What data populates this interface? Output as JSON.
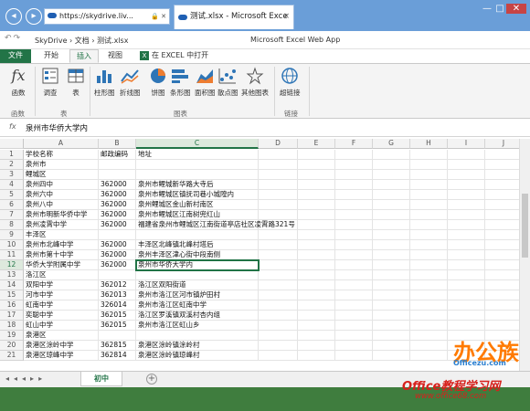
{
  "browser": {
    "address": "https://skydrive.liv...",
    "tab_title": "测试.xlsx - Microsoft Exce",
    "tab_close": "×",
    "win_min": "—",
    "win_max": "□",
    "win_close": "✕"
  },
  "appbar": {
    "breadcrumb": "SkyDrive  ›  文档  ›  测试.xlsx",
    "app_title": "Microsoft Excel Web App"
  },
  "ribbon_tabs": {
    "file": "文件",
    "home": "开始",
    "insert": "插入",
    "view": "视图",
    "open_excel": "在 EXCEL 中打开"
  },
  "ribbon": {
    "function": "函数",
    "survey": "调查",
    "table": "表",
    "column": "柱形图",
    "line": "折线图",
    "pie": "饼图",
    "bar": "条形图",
    "area": "面积图",
    "scatter": "散点图",
    "other": "其他图表",
    "hyperlink": "超链接",
    "group_function": "函数",
    "group_table": "表",
    "group_chart": "图表",
    "group_link": "链接"
  },
  "formula_bar": {
    "fx": "fx",
    "value": "泉州市华侨大学内"
  },
  "columns": [
    "A",
    "B",
    "C",
    "D",
    "E",
    "F",
    "G",
    "H",
    "I",
    "J"
  ],
  "selected_column": "C",
  "selected_row": 12,
  "rows": [
    {
      "n": "1",
      "a": "学校名称",
      "b": "邮政编码",
      "c": "地址"
    },
    {
      "n": "2",
      "a": "泉州市",
      "b": "",
      "c": ""
    },
    {
      "n": "3",
      "a": "鲤城区",
      "b": "",
      "c": ""
    },
    {
      "n": "4",
      "a": "泉州四中",
      "b": "362000",
      "c": "泉州市鲤城新华路大寺后"
    },
    {
      "n": "5",
      "a": "泉州六中",
      "b": "362000",
      "c": "泉州市鲤城区镇抚司巷小城隍内"
    },
    {
      "n": "6",
      "a": "泉州八中",
      "b": "362000",
      "c": "泉州鲤城区金山新村南区"
    },
    {
      "n": "7",
      "a": "泉州市明新华侨中学",
      "b": "362000",
      "c": "泉州市鲤城区江南树兜红山"
    },
    {
      "n": "8",
      "a": "泉州凌霄中学",
      "b": "362000",
      "c": "福建省泉州市鲤城区江南街道亭店社区凌霄路321号"
    },
    {
      "n": "9",
      "a": "丰泽区",
      "b": "",
      "c": ""
    },
    {
      "n": "10",
      "a": "泉州市北峰中学",
      "b": "362000",
      "c": "丰泽区北峰镇北峰村塔后"
    },
    {
      "n": "11",
      "a": "泉州市第十中学",
      "b": "362000",
      "c": "泉州丰泽区津心街中段南侧"
    },
    {
      "n": "12",
      "a": "华侨大学附属中学",
      "b": "362000",
      "c": "泉州市华侨大学内"
    },
    {
      "n": "13",
      "a": "洛江区",
      "b": "",
      "c": ""
    },
    {
      "n": "14",
      "a": "双阳中学",
      "b": "362012",
      "c": "洛江区双阳街道"
    },
    {
      "n": "15",
      "a": "河市中学",
      "b": "362013",
      "c": "泉州市洛江区河市镇炉田村"
    },
    {
      "n": "16",
      "a": "虹南中学",
      "b": "326014",
      "c": "泉州市洛江区虹南中学"
    },
    {
      "n": "17",
      "a": "奕聪中学",
      "b": "362015",
      "c": "洛江区罗溪镇双溪村杏内组"
    },
    {
      "n": "18",
      "a": "虹山中学",
      "b": "362015",
      "c": "泉州市洛江区虹山乡"
    },
    {
      "n": "19",
      "a": "泉港区",
      "b": "",
      "c": ""
    },
    {
      "n": "20",
      "a": "泉港区涂岭中学",
      "b": "362815",
      "c": "泉港区涂岭镇涂岭村"
    },
    {
      "n": "21",
      "a": "泉港区琼峰中学",
      "b": "362814",
      "c": "泉港区涂岭镇琼峰村"
    }
  ],
  "sheet_tabs": {
    "nav": "◂◂◂▸▸",
    "current": "初中",
    "add": "+"
  },
  "watermark": {
    "brand": "办公族",
    "brand_url": "Officezu.com",
    "site": "Office教程学习网",
    "site_url": "www.office68.com"
  }
}
